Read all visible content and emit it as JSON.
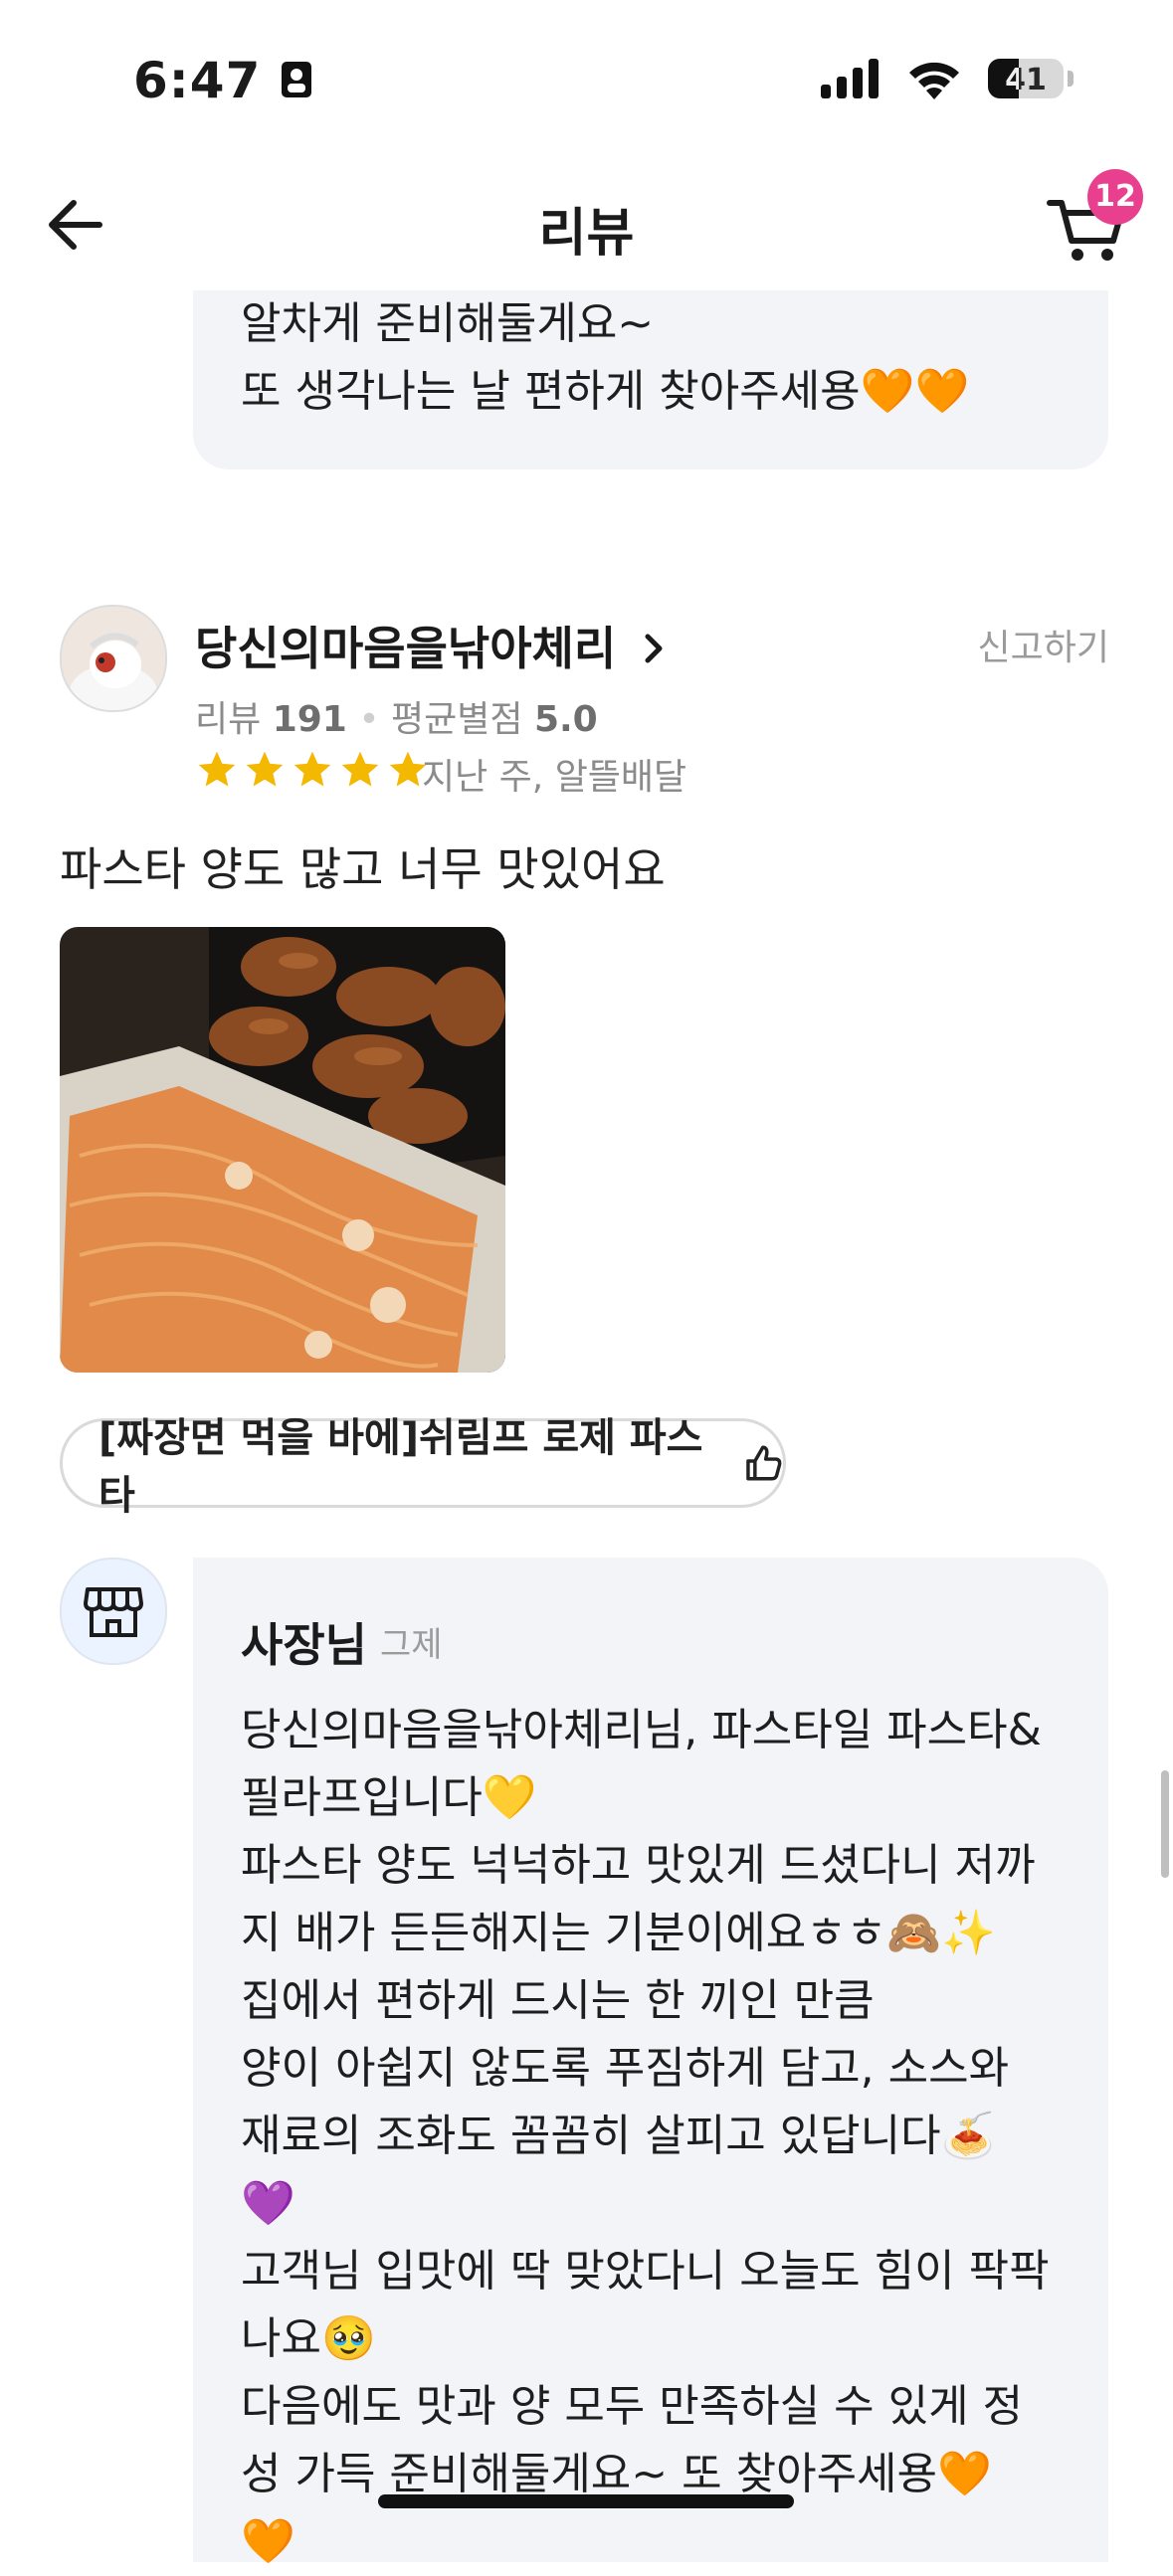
{
  "status_bar": {
    "time": "6:47",
    "battery": "41",
    "battery_level": 0.41
  },
  "header": {
    "title": "리뷰",
    "cart_count": "12"
  },
  "prev_reply": {
    "lines": "알차게 준비해둘게요~\n또 생각나는 날 편하게 찾아주세용🧡🧡"
  },
  "review": {
    "reviewer_name": "당신의마음을낚아체리",
    "report_label": "신고하기",
    "review_count_label": "리뷰",
    "review_count": "191",
    "avg_rating_label": "평균별점",
    "avg_rating": "5.0",
    "stars": 5,
    "delivery_info": "지난 주, 알뜰배달",
    "text": "파스타 양도 많고 너무 맛있어요",
    "menu_item": "[짜장면 먹을 바에]쉬림프 로제 파스타"
  },
  "owner_reply": {
    "name": "사장님",
    "date": "그제",
    "text": "당신의마음을낚아체리님, 파스타일 파스타&\n필라프입니다💛\n파스타 양도 넉넉하고 맛있게 드셨다니 저까\n지 배가 든든해지는 기분이에요ㅎㅎ🙈✨\n집에서 편하게 드시는 한 끼인 만큼\n양이 아쉽지 않도록 푸짐하게 담고, 소스와\n재료의 조화도 꼼꼼히 살피고 있답니다🍝\n💜\n고객님 입맛에 딱 맞았다니 오늘도 힘이 팍팍\n나요🥹\n다음에도 맛과 양 모두 만족하실 수 있게 정\n성 가득 준비해둘게요~ 또 찾아주세용🧡\n🧡"
  },
  "colors": {
    "badge": "#e8408e",
    "star": "#f5b800",
    "bubble": "#f3f4f7"
  }
}
